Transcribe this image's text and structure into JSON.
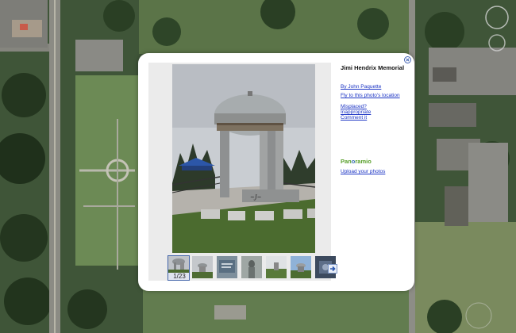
{
  "popup": {
    "title": "Jimi Hendrix Memorial",
    "author_link": "By John Paquette",
    "fly_link": "Fly to this photo's location",
    "report_links": [
      "Misplaced?",
      "Inappropriate",
      "Comment it"
    ],
    "logo_text": "Panoramio",
    "upload_link": "Upload your photos",
    "counter": "1/23",
    "thumbnails": [
      "memorial",
      "memorial-far",
      "plaque",
      "statue",
      "grounds",
      "memorial-sky",
      "dark-detail"
    ]
  },
  "colors": {
    "link": "#1a33c4",
    "logo_green": "#5aa02c",
    "logo_blue": "#3a6fb5",
    "popup_bg": "#ffffff",
    "map_green": "#3d5236"
  },
  "icons": [
    "close-icon",
    "next-arrow-icon",
    "panoramio-logo"
  ]
}
